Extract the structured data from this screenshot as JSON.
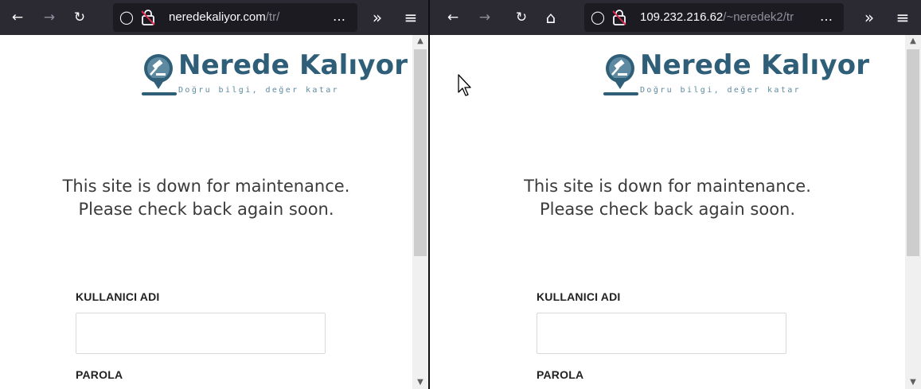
{
  "windows": {
    "left": {
      "url_host": "neredekaliyor.com",
      "url_path": "/tr/",
      "toolbar_overflow": "…",
      "extensions_chevron": "»",
      "menu": "≡"
    },
    "right": {
      "url_host": "109.232.216.62",
      "url_path": "/~neredek2/tr",
      "toolbar_overflow": "…",
      "extensions_chevron": "»",
      "menu": "≡"
    }
  },
  "icons": {
    "back": "←",
    "forward": "→",
    "reload": "↻",
    "home": "⌂",
    "shield": "◯"
  },
  "site": {
    "logo_title": "Nerede Kalıyor",
    "logo_tagline": "Doğru bilgi, değer katar",
    "maintenance_line1": "This site is down for maintenance.",
    "maintenance_line2": "Please check back again soon.",
    "username_label": "KULLANICI ADI",
    "username_value": "",
    "password_label": "PAROLA"
  },
  "colors": {
    "toolbar": "#2b2a33",
    "urlbar": "#1c1b22",
    "logo_primary": "#2f5f78",
    "logo_secondary": "#5d8aa0",
    "lock_slash": "#e22850"
  }
}
